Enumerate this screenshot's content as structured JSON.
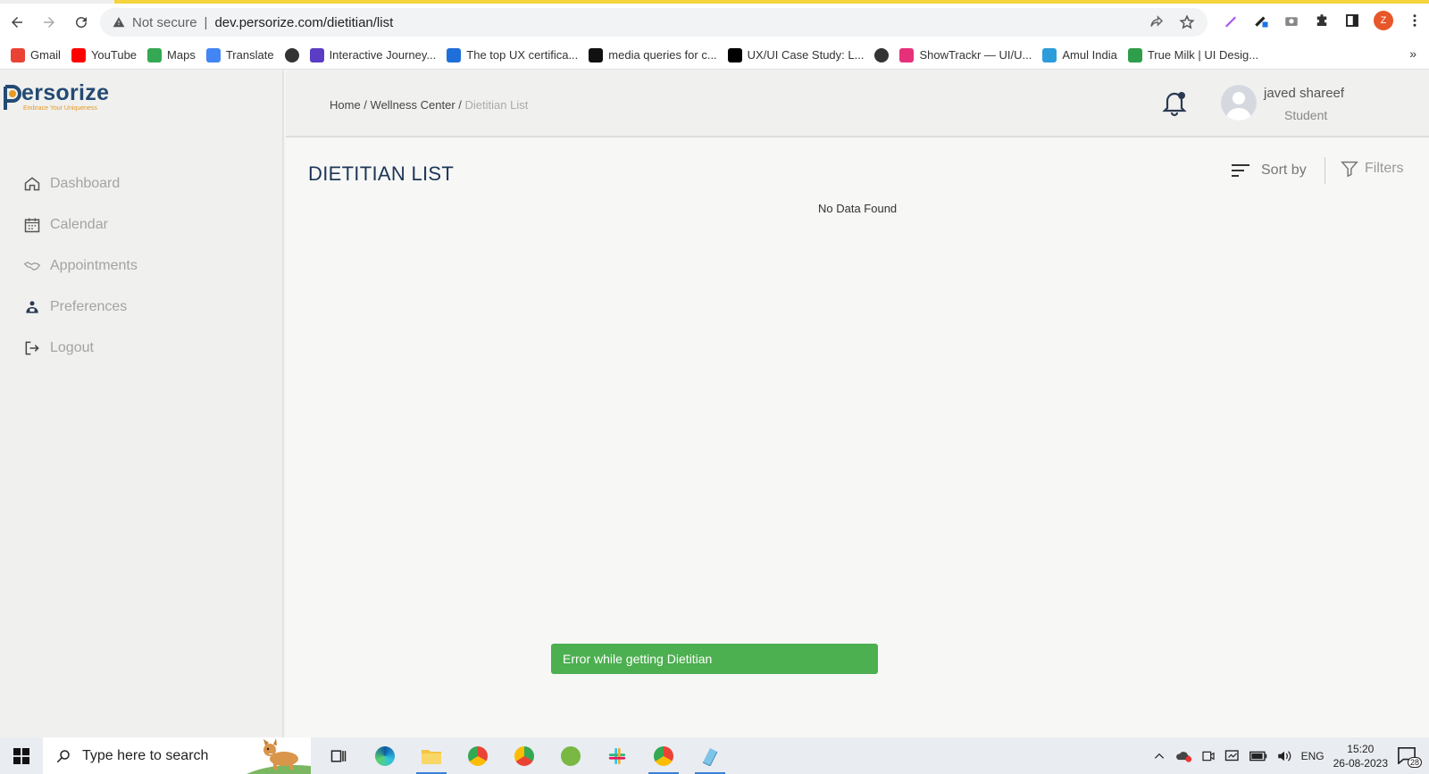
{
  "browser": {
    "security_label": "Not secure",
    "url": "dev.persorize.com/dietitian/list",
    "profile_initial": "Z",
    "bookmarks": [
      {
        "label": "Gmail",
        "icon": "gmail-icon",
        "color": "#ea4335"
      },
      {
        "label": "YouTube",
        "icon": "youtube-icon",
        "color": "#ff0000"
      },
      {
        "label": "Maps",
        "icon": "maps-icon",
        "color": "#34a853"
      },
      {
        "label": "Translate",
        "icon": "translate-icon",
        "color": "#4285f4"
      },
      {
        "label": "",
        "icon": "globe-icon",
        "color": "#333333"
      },
      {
        "label": "Interactive Journey...",
        "icon": "crown-icon",
        "color": "#5b3cc4"
      },
      {
        "label": "The top UX certifica...",
        "icon": "shield-u-icon",
        "color": "#1e6fd9"
      },
      {
        "label": "media queries for c...",
        "icon": "u-badge-icon",
        "color": "#111111"
      },
      {
        "label": "UX/UI Case Study: L...",
        "icon": "medium-icon",
        "color": "#000000"
      },
      {
        "label": "",
        "icon": "globe-icon",
        "color": "#333333"
      },
      {
        "label": "ShowTrackr — UI/U...",
        "icon": "m-pink-icon",
        "color": "#e6317a"
      },
      {
        "label": "Amul India",
        "icon": "m-blue-icon",
        "color": "#2d9cdb"
      },
      {
        "label": "True Milk | UI Desig...",
        "icon": "leaf-icon",
        "color": "#2e9e4a"
      }
    ],
    "more": "»"
  },
  "app": {
    "logo": {
      "name": "ersorize",
      "tagline": "Embrace Your Uniqueness"
    },
    "sidebar": {
      "items": [
        {
          "label": "Dashboard",
          "icon": "home-icon"
        },
        {
          "label": "Calendar",
          "icon": "calendar-icon"
        },
        {
          "label": "Appointments",
          "icon": "handshake-icon"
        },
        {
          "label": "Preferences",
          "icon": "preferences-icon"
        },
        {
          "label": "Logout",
          "icon": "logout-icon"
        }
      ]
    },
    "header": {
      "breadcrumb": {
        "home": "Home",
        "sep1": " / ",
        "section": "Wellness Center",
        "sep2": " / ",
        "current": "Dietitian List"
      },
      "user": {
        "name": "javed shareef",
        "role": "Student"
      }
    },
    "main": {
      "title": "DIETITIAN LIST",
      "sort_label": "Sort by",
      "filters_label": "Filters",
      "empty_message": "No Data Found",
      "toast": "Error while getting Dietitian"
    }
  },
  "taskbar": {
    "search_placeholder": "Type here to search",
    "language": "ENG",
    "time": "15:20",
    "date": "26-08-2023",
    "notification_count": "28"
  },
  "colors": {
    "brand": "#234a73",
    "accent": "#e69a22",
    "toast": "#4caf50"
  }
}
